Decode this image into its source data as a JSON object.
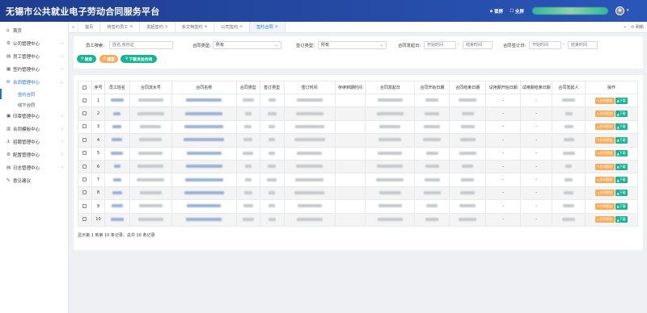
{
  "app": {
    "title": "无锡市公共就业电子劳动合同服务平台",
    "lock_label": "锁屏",
    "fullscreen_label": "全屏",
    "caret": "▾"
  },
  "sidebar": {
    "items": [
      {
        "icon": "⌂",
        "label": "首页",
        "arrow": ""
      },
      {
        "icon": "⚙",
        "label": "公司管理中心",
        "arrow": "‹"
      },
      {
        "icon": "▤",
        "label": "员工管理中心",
        "arrow": "‹"
      },
      {
        "icon": "▦",
        "label": "签约管理中心",
        "arrow": "‹"
      },
      {
        "icon": "✉",
        "label": "合同管理中心",
        "arrow": "⌄"
      }
    ],
    "subitems": [
      {
        "label": "签约合同"
      },
      {
        "label": "线下合同"
      }
    ],
    "items2": [
      {
        "icon": "▣",
        "label": "印章管理中心",
        "arrow": "‹"
      },
      {
        "icon": "▥",
        "label": "合同模板中心",
        "arrow": "‹"
      },
      {
        "icon": "⚓",
        "label": "招聘管理中心",
        "arrow": "‹"
      },
      {
        "icon": "⚙",
        "label": "配置管理中心",
        "arrow": "‹"
      },
      {
        "icon": "▤",
        "label": "日志管理中心",
        "arrow": "‹"
      },
      {
        "icon": "✎",
        "label": "意见建议",
        "arrow": ""
      }
    ]
  },
  "tabs": {
    "nav_left": "«",
    "items": [
      {
        "label": "首页",
        "closable": false,
        "active": false
      },
      {
        "label": "待签约员工",
        "closable": true,
        "active": false
      },
      {
        "label": "发起签约",
        "closable": true,
        "active": false
      },
      {
        "label": "多文档签约",
        "closable": true,
        "active": false
      },
      {
        "label": "公司签约",
        "closable": true,
        "active": false
      },
      {
        "label": "签约合同",
        "closable": true,
        "active": true
      }
    ],
    "close_glyph": "⊗",
    "nav_right": "»",
    "refresh_label": "刷新"
  },
  "filter": {
    "employee_search_label": "员工搜索:",
    "employee_search_placeholder": "姓名,身份证",
    "contract_type_label": "合同类型:",
    "contract_type_value": "所有",
    "sign_type_label": "签订类型:",
    "sign_type_value": "所有",
    "initiate_date_label": "合同发起日:",
    "sign_date_label": "合同签订日:",
    "start_placeholder": "开始时间",
    "end_placeholder": "结束时间",
    "dash": "-",
    "search_button": "搜索",
    "reset_button": "重置",
    "download_button": "下载发送合同"
  },
  "table": {
    "headers": [
      "序号",
      "员工姓名",
      "合同流水号",
      "合同名称",
      "合同类型",
      "签订类型",
      "签订时间",
      "存续到期时间",
      "合同发起日",
      "合同开始日期",
      "合同结束日期",
      "试用期开始日期",
      "试用期结束日期",
      "合同发起人",
      "操作"
    ],
    "rows": [
      {
        "no": "1",
        "probation_start": "-",
        "probation_end": "-"
      },
      {
        "no": "2",
        "probation_start": "-",
        "probation_end": "-"
      },
      {
        "no": "3",
        "probation_start": "-",
        "probation_end": "-"
      },
      {
        "no": "4",
        "probation_start": "-",
        "probation_end": "-"
      },
      {
        "no": "5",
        "probation_start": "-",
        "probation_end": "-"
      },
      {
        "no": "6",
        "probation_start": "-",
        "probation_end": "-"
      },
      {
        "no": "7",
        "probation_start": "-",
        "probation_end": "-"
      },
      {
        "no": "8",
        "probation_start": "-",
        "probation_end": "-"
      },
      {
        "no": "9",
        "probation_start": "-",
        "probation_end": "-"
      },
      {
        "no": "10",
        "probation_start": "-",
        "probation_end": "-"
      }
    ],
    "preview_label": "合同预览",
    "download_label": "下载",
    "pager_text": "显示第 1 到第 10 条记录，总共 10 条记录"
  }
}
